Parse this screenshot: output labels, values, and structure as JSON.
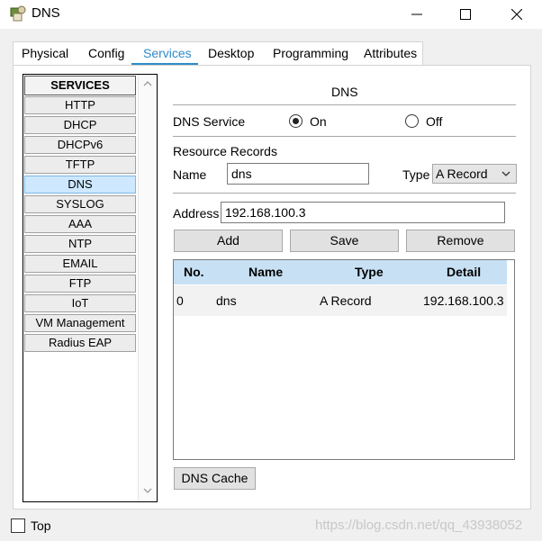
{
  "window": {
    "title": "DNS"
  },
  "tabs": [
    {
      "label": "Physical"
    },
    {
      "label": "Config"
    },
    {
      "label": "Services",
      "active": true
    },
    {
      "label": "Desktop"
    },
    {
      "label": "Programming"
    },
    {
      "label": "Attributes"
    }
  ],
  "sidebar": {
    "header": "SERVICES",
    "items": [
      "HTTP",
      "DHCP",
      "DHCPv6",
      "TFTP",
      "DNS",
      "SYSLOG",
      "AAA",
      "NTP",
      "EMAIL",
      "FTP",
      "IoT",
      "VM Management",
      "Radius EAP"
    ],
    "active": "DNS"
  },
  "dns": {
    "heading": "DNS",
    "service_label": "DNS Service",
    "on_label": "On",
    "off_label": "Off",
    "service_state": "On",
    "records_label": "Resource Records",
    "name_label": "Name",
    "name_value": "dns",
    "type_label": "Type",
    "type_value": "A Record",
    "address_label": "Address",
    "address_value": "192.168.100.3",
    "add_label": "Add",
    "save_label": "Save",
    "remove_label": "Remove",
    "cache_label": "DNS Cache"
  },
  "table": {
    "columns": [
      "No.",
      "Name",
      "Type",
      "Detail"
    ],
    "rows": [
      {
        "no": "0",
        "name": "dns",
        "type": "A Record",
        "detail": "192.168.100.3"
      }
    ]
  },
  "footer": {
    "top_label": "Top",
    "top_checked": false,
    "watermark": "https://blog.csdn.net/qq_43938052"
  },
  "colors": {
    "accent": "#2e8bc9",
    "selection": "#cde8ff",
    "table_header": "#c7e0f4"
  }
}
